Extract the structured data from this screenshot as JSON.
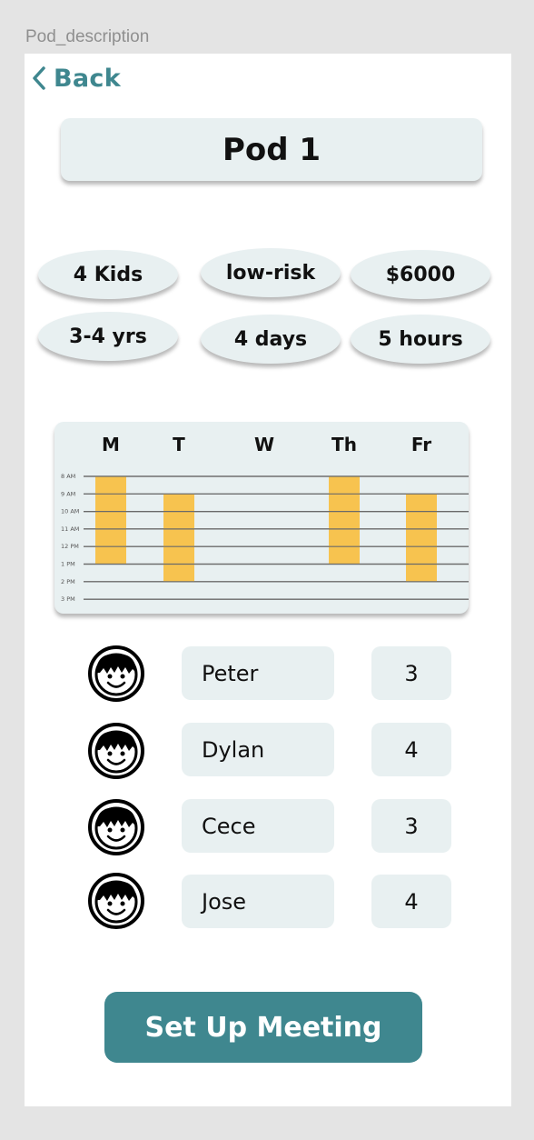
{
  "frame_label": "Pod_description",
  "nav": {
    "back_label": "Back"
  },
  "title": "Pod 1",
  "stats": [
    "4 Kids",
    "low-risk",
    "$6000",
    "3-4 yrs",
    "4 days",
    "5 hours"
  ],
  "schedule": {
    "days": [
      "M",
      "T",
      "W",
      "Th",
      "Fr"
    ],
    "times": [
      "8 AM",
      "9 AM",
      "10 AM",
      "11 AM",
      "12 PM",
      "1 PM",
      "2 PM",
      "3 PM"
    ],
    "bar_color": "#f7c34f",
    "blocks": [
      {
        "day": "M",
        "start": "8 AM",
        "end": "1 PM"
      },
      {
        "day": "T",
        "start": "9 AM",
        "end": "2 PM"
      },
      {
        "day": "Th",
        "start": "8 AM",
        "end": "1 PM"
      },
      {
        "day": "Fr",
        "start": "9 AM",
        "end": "2 PM"
      }
    ]
  },
  "kids": [
    {
      "name": "Peter",
      "age": "3"
    },
    {
      "name": "Dylan",
      "age": "4"
    },
    {
      "name": "Cece",
      "age": "3"
    },
    {
      "name": "Jose",
      "age": "4"
    }
  ],
  "cta_label": "Set Up Meeting",
  "colors": {
    "accent": "#3f878f",
    "surface": "#e8f0f1",
    "highlight": "#f7c34f"
  },
  "icons": {
    "back": "chevron-left-icon",
    "avatar": "kid-face-icon"
  }
}
